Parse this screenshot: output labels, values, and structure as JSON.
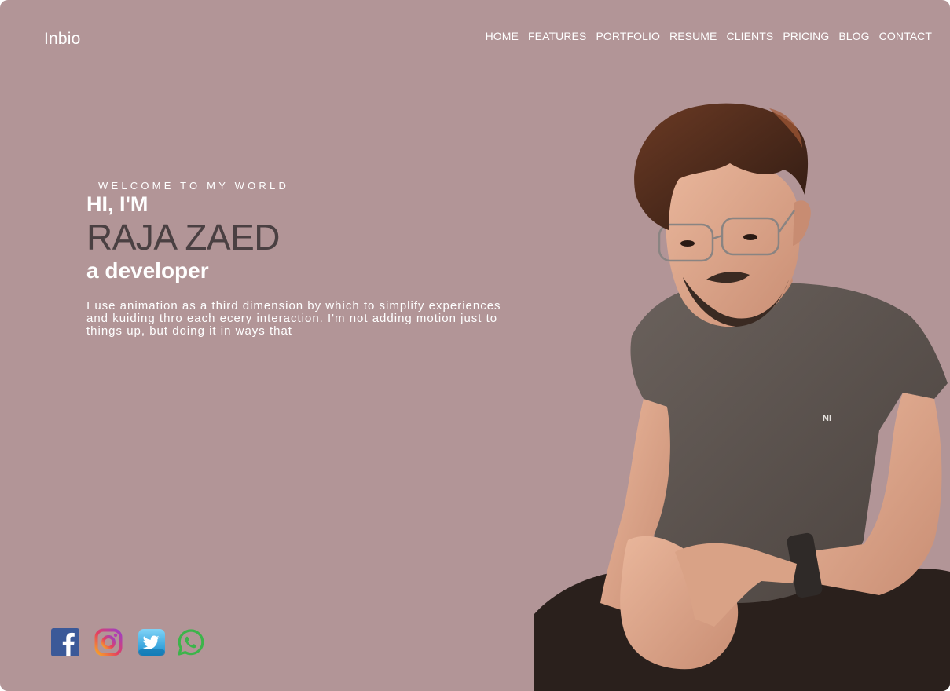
{
  "brand": {
    "logo": "Inbio"
  },
  "nav": {
    "items": [
      "HOME",
      "FEATURES",
      "PORTFOLIO",
      "RESUME",
      "CLIENTS",
      "PRICING",
      "BLOG",
      "CONTACT"
    ]
  },
  "hero": {
    "welcome": "WELCOME TO MY WORLD",
    "greeting": "HI, I'M",
    "name": "RAJA ZAED",
    "role": "a developer",
    "description_lines": [
      "I use animation as a third dimension by which to simplify experiences",
      "and kuiding thro each ecery interaction. I'm not adding motion just to",
      "things up, but doing it in ways that"
    ]
  },
  "socials": {
    "icons": [
      "facebook-icon",
      "instagram-icon",
      "twitter-icon",
      "whatsapp-icon"
    ]
  },
  "colors": {
    "background": "#b29597",
    "text": "#ffffff",
    "name_text": "#4a4042"
  }
}
